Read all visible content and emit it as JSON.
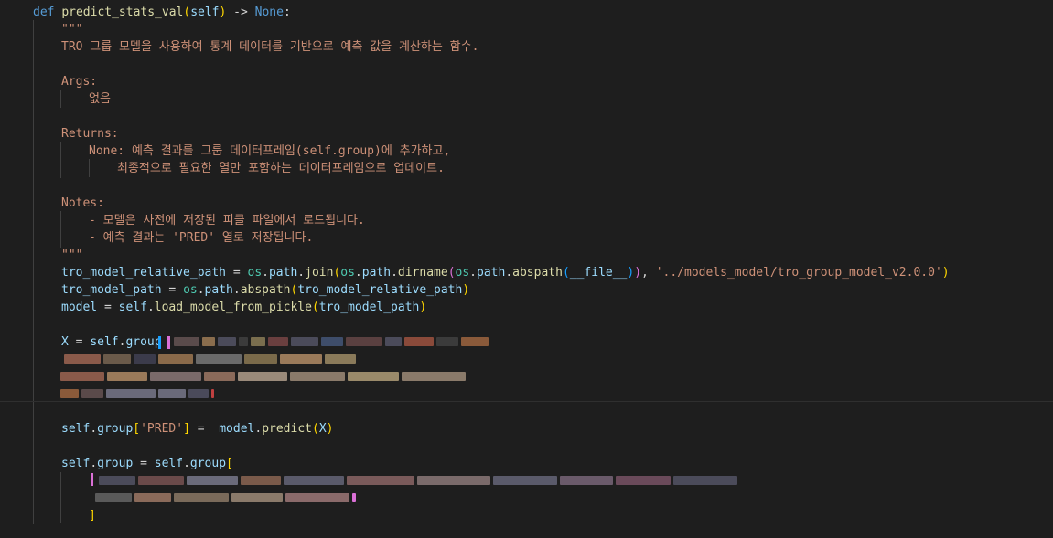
{
  "code": {
    "def_kw": "def",
    "func_name": "predict_stats_val",
    "self_param": "self",
    "arrow": "->",
    "none_kw": "None",
    "docstring_open": "\"\"\"",
    "doc_summary": "TRO 그룹 모델을 사용하여 통계 데이터를 기반으로 예측 값을 계산하는 함수.",
    "args_header": "Args:",
    "args_value": "없음",
    "returns_header": "Returns:",
    "returns_line1": "None: 예측 결과를 그룹 데이터프레임(self.group)에 추가하고,",
    "returns_line2": "최종적으로 필요한 열만 포함하는 데이터프레임으로 업데이트.",
    "notes_header": "Notes:",
    "notes_line1": "- 모델은 사전에 저장된 피클 파일에서 로드됩니다.",
    "notes_line2": "- 예측 결과는 'PRED' 열로 저장됩니다.",
    "docstring_close": "\"\"\"",
    "rel_path_var": "tro_model_relative_path",
    "os_mod": "os",
    "path_attr": "path",
    "join_fn": "join",
    "dirname_fn": "dirname",
    "abspath_fn": "abspath",
    "file_dunder": "__file__",
    "model_path_str": "'../models_model/tro_group_model_v2.0.0'",
    "model_path_var": "tro_model_path",
    "model_var": "model",
    "load_fn": "load_model_from_pickle",
    "x_var": "X",
    "group_attr": "group",
    "pred_key": "'PRED'",
    "predict_fn": "predict",
    "close_bracket": "]"
  },
  "colors": {
    "background": "#1e1e1e",
    "keyword": "#569cd6",
    "function": "#dcdcaa",
    "variable": "#9cdcfe",
    "module": "#4ec9b0",
    "string": "#ce9178"
  }
}
